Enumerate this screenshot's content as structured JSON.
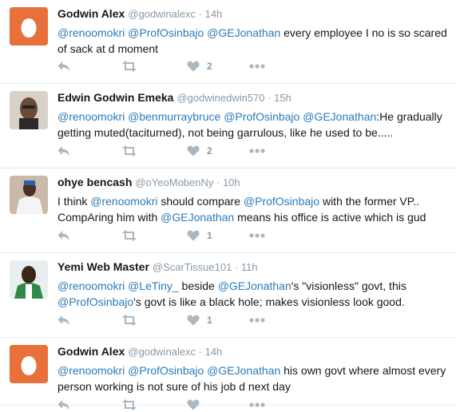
{
  "tweets": [
    {
      "name": "Godwin Alex",
      "handle": "@godwinalexc",
      "time": "14h",
      "avatar": "egg",
      "parts": [
        {
          "t": "@renoomokri",
          "m": true
        },
        {
          "t": " ",
          "m": false
        },
        {
          "t": "@ProfOsinbajo",
          "m": true
        },
        {
          "t": " ",
          "m": false
        },
        {
          "t": "@GEJonathan",
          "m": true
        },
        {
          "t": " every employee I no is so scared of sack at d moment",
          "m": false
        }
      ],
      "likes": "2"
    },
    {
      "name": "Edwin Godwin Emeka",
      "handle": "@godwinedwin570",
      "time": "15h",
      "avatar": "photo-man-beard",
      "parts": [
        {
          "t": "@renoomokri",
          "m": true
        },
        {
          "t": " ",
          "m": false
        },
        {
          "t": "@benmurraybruce",
          "m": true
        },
        {
          "t": " ",
          "m": false
        },
        {
          "t": "@ProfOsinbajo",
          "m": true
        },
        {
          "t": " ",
          "m": false
        },
        {
          "t": "@GEJonathan",
          "m": true
        },
        {
          "t": ":He gradually getting muted(taciturned), not being garrulous, like he used to be.....",
          "m": false
        }
      ],
      "likes": "2"
    },
    {
      "name": "ohye bencash",
      "handle": "@oYeoMobenNy",
      "time": "10h",
      "avatar": "photo-man-white",
      "parts": [
        {
          "t": "I think ",
          "m": false
        },
        {
          "t": "@renoomokri",
          "m": true
        },
        {
          "t": " should compare ",
          "m": false
        },
        {
          "t": "@ProfOsinbajo",
          "m": true
        },
        {
          "t": " with the former VP.. CompAring him with ",
          "m": false
        },
        {
          "t": "@GEJonathan",
          "m": true
        },
        {
          "t": " means his office is active which is gud",
          "m": false
        }
      ],
      "likes": "1"
    },
    {
      "name": "Yemi Web Master",
      "handle": "@ScarTissue101",
      "time": "11h",
      "avatar": "photo-man-green",
      "parts": [
        {
          "t": "@renoomokri",
          "m": true
        },
        {
          "t": " ",
          "m": false
        },
        {
          "t": "@LeTiny_",
          "m": true
        },
        {
          "t": " beside ",
          "m": false
        },
        {
          "t": "@GEJonathan",
          "m": true
        },
        {
          "t": "'s \"visionless\" govt, this ",
          "m": false
        },
        {
          "t": "@ProfOsinbajo",
          "m": true
        },
        {
          "t": "'s govt is like a black hole; makes visionless look good.",
          "m": false
        }
      ],
      "likes": "1"
    },
    {
      "name": "Godwin Alex",
      "handle": "@godwinalexc",
      "time": "14h",
      "avatar": "egg",
      "parts": [
        {
          "t": "@renoomokri",
          "m": true
        },
        {
          "t": " ",
          "m": false
        },
        {
          "t": "@ProfOsinbajo",
          "m": true
        },
        {
          "t": " ",
          "m": false
        },
        {
          "t": "@GEJonathan",
          "m": true
        },
        {
          "t": " his own govt where almost every person working is not sure of his job d next day",
          "m": false
        }
      ],
      "likes": ""
    }
  ],
  "colors": {
    "mention": "#2b7bb9",
    "meta": "#8899a6",
    "icon": "#aab8c2",
    "egg_bg": "#e8703a"
  }
}
